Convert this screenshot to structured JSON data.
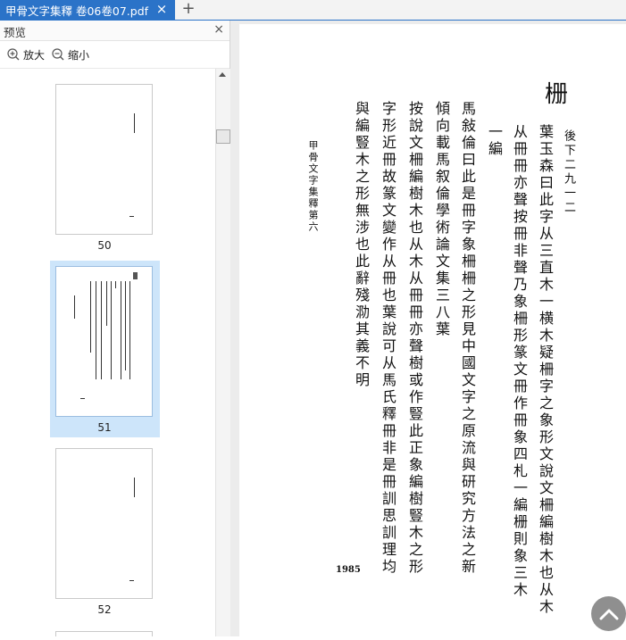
{
  "tab": {
    "title": "甲骨文字集釋 卷06卷07.pdf",
    "close_symbol": "×",
    "add_symbol": "+"
  },
  "panel": {
    "title": "预览",
    "close_symbol": "×",
    "zoom_in_label": "放大",
    "zoom_out_label": "缩小"
  },
  "thumbnails": [
    {
      "label": "50",
      "selected": false
    },
    {
      "label": "51",
      "selected": true
    },
    {
      "label": "52",
      "selected": false
    }
  ],
  "page": {
    "side_title": "甲骨文字集釋第六",
    "page_number": "1985",
    "columns": [
      "栅",
      "後下二九一二",
      "葉玉森曰此字从三直木一横木疑柵字之象形文說文柵編樹木也从木",
      "从冊冊亦聲按冊非聲乃象柵形篆文冊作冊象四札一編栅則象三木",
      "一編",
      "馬敍倫曰此是冊字象柵柵之形見中國文字之原流與研究方法之新",
      "傾向載馬叙倫學術論文集三八葉",
      "按說文柵編樹木也从木从冊冊亦聲樹或作豎此正象編樹豎木之形",
      "字形近冊故篆文變作从冊也葉說可从馬氏釋冊非是冊訓思訓理均",
      "與編豎木之形無涉也此辭殘泐其義不明"
    ]
  },
  "colors": {
    "accent": "#2b73c8",
    "selection": "#cde5fa"
  },
  "icons": [
    "close-icon",
    "add-tab-icon",
    "zoom-in-icon",
    "zoom-out-icon",
    "scroll-up-icon",
    "back-to-top-icon"
  ]
}
